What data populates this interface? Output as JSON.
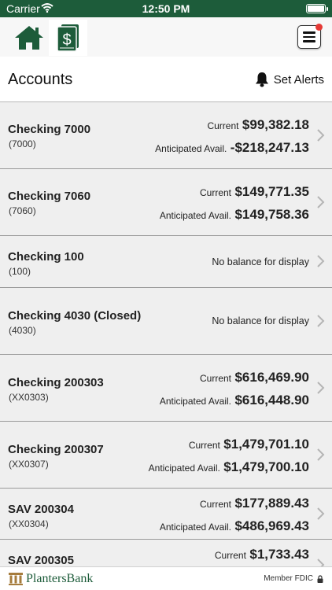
{
  "status_bar": {
    "carrier": "Carrier",
    "time": "12:50 PM"
  },
  "header": {
    "title": "Accounts",
    "alerts_label": "Set Alerts"
  },
  "accounts": [
    {
      "name": "Checking 7000",
      "number": "(7000)",
      "current_label": "Current",
      "current": "$99,382.18",
      "anticipated_label": "Anticipated Avail.",
      "anticipated": "-$218,247.13"
    },
    {
      "name": "Checking 7060",
      "number": "(7060)",
      "current_label": "Current",
      "current": "$149,771.35",
      "anticipated_label": "Anticipated Avail.",
      "anticipated": "$149,758.36"
    },
    {
      "name": "Checking 100",
      "number": "(100)",
      "no_balance": "No balance for display"
    },
    {
      "name": "Checking 4030 (Closed)",
      "number": "(4030)",
      "no_balance": "No balance for display"
    },
    {
      "name": "Checking 200303",
      "number": "(XX0303)",
      "current_label": "Current",
      "current": "$616,469.90",
      "anticipated_label": "Anticipated Avail.",
      "anticipated": "$616,448.90"
    },
    {
      "name": "Checking 200307",
      "number": "(XX0307)",
      "current_label": "Current",
      "current": "$1,479,701.10",
      "anticipated_label": "Anticipated Avail.",
      "anticipated": "$1,479,700.10"
    },
    {
      "name": "SAV 200304",
      "number": "(XX0304)",
      "current_label": "Current",
      "current": "$177,889.43",
      "anticipated_label": "Anticipated Avail.",
      "anticipated": "$486,969.43"
    },
    {
      "name": "SAV 200305",
      "current_label": "Current",
      "current": "$1,733.43"
    }
  ],
  "footer": {
    "bank_name": "PlantersBank",
    "fdic": "Member FDIC"
  },
  "colors": {
    "brand_green": "#1d5c3a",
    "alert_dot": "#e53935",
    "row_bg": "#efefef"
  },
  "icons": [
    "wifi-icon",
    "battery-icon",
    "home-icon",
    "dollar-document-icon",
    "hamburger-menu-icon",
    "bell-icon",
    "chevron-right-icon",
    "bank-column-logo-icon",
    "lock-icon"
  ]
}
